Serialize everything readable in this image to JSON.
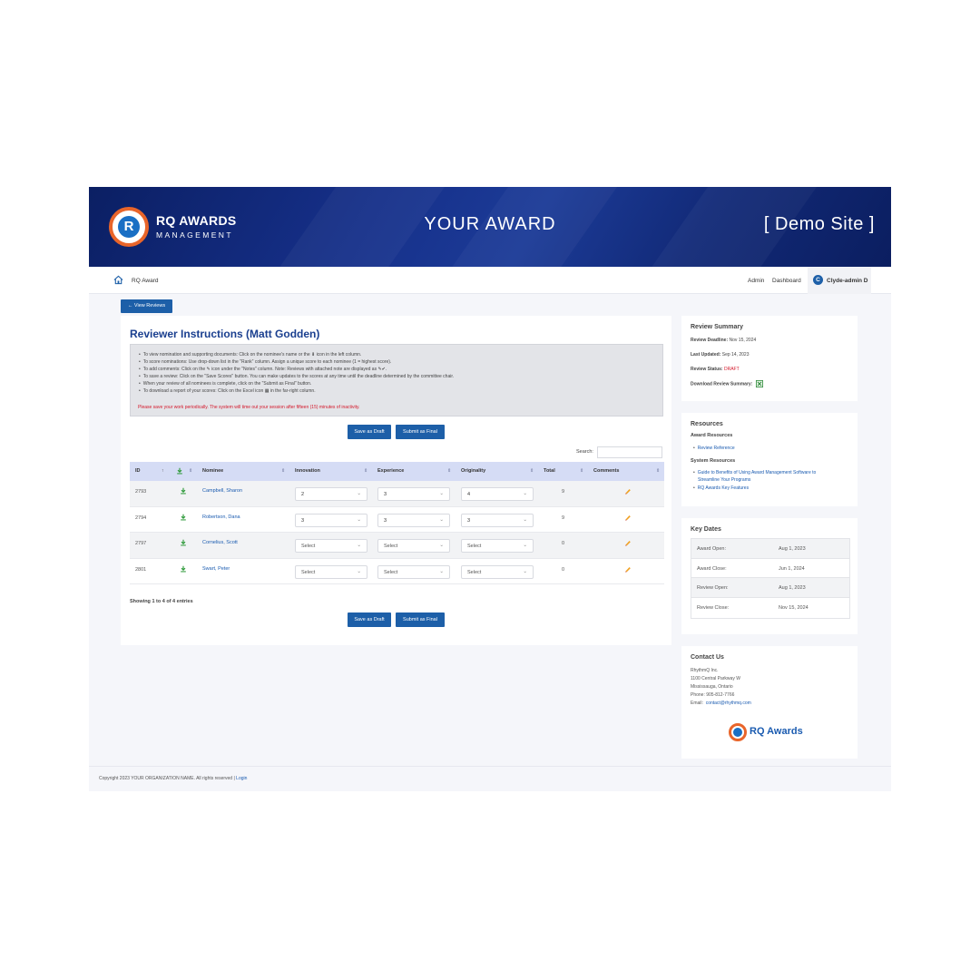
{
  "banner": {
    "brand_name": "RQ AWARDS",
    "brand_sub": "MANAGEMENT",
    "logo_letter": "R",
    "award_title": "YOUR  AWARD",
    "site_label": "[ Demo Site ]"
  },
  "navbar": {
    "breadcrumb": "RQ Award",
    "admin": "Admin",
    "dashboard": "Dashboard",
    "user_initial": "C",
    "user_name": "Clyde-admin D"
  },
  "view_reviews_label": "← View Reviews",
  "instructions": {
    "title": "Reviewer Instructions (Matt Godden)",
    "items": [
      "To view nomination and supporting documents: Click on the nominee's name or the ⬇ icon in the left column.",
      "To score nominations: Use drop-down list in the \"Rank\" column.  Assign a unique score to each nominee (1 =  highest score).",
      "To add comments: Click on the ✎ icon under the \"Notes\" column.  Note: Reviews with attached note are displayed as ✎✔.",
      "To save a review: Click on the \"Save Scores\" button.  You can make updates to the scores at any time until the deadline determined by the committee chair.",
      "When your review of all nominees is complete, click on the \"Submit as Final\" button.",
      "To download a report of your scores: Click on the Excel icon ▦ in the far-right column."
    ],
    "warning": "Please save your work periodically. The system will time out your session after fifteen (15) minutes of inactivity."
  },
  "actions": {
    "save_draft": "Save as Draft",
    "submit_final": "Submit as Final"
  },
  "search_label": "Search:",
  "table": {
    "columns": [
      "ID",
      "Nominee",
      "Innovation",
      "Experience",
      "Originality",
      "Total",
      "Comments"
    ],
    "rows": [
      {
        "id": "2793",
        "nominee": "Campbell, Sharon",
        "innovation": "2",
        "experience": "3",
        "originality": "4",
        "total": "9"
      },
      {
        "id": "2794",
        "nominee": "Robertson, Dana",
        "innovation": "3",
        "experience": "3",
        "originality": "3",
        "total": "9"
      },
      {
        "id": "2797",
        "nominee": "Cornelius, Scott",
        "innovation": "Select",
        "experience": "Select",
        "originality": "Select",
        "total": "0"
      },
      {
        "id": "2801",
        "nominee": "Swart, Peter",
        "innovation": "Select",
        "experience": "Select",
        "originality": "Select",
        "total": "0"
      }
    ],
    "showing": "Showing 1 to 4 of 4 entries"
  },
  "summary": {
    "title": "Review Summary",
    "deadline_label": "Review Deadline:",
    "deadline": "Nov 15, 2024",
    "updated_label": "Last Updated:",
    "updated": "Sep 14, 2023",
    "status_label": "Review Status:",
    "status": "DRAFT",
    "download_label": "Download Review Summary:"
  },
  "resources": {
    "title": "Resources",
    "award_heading": "Award Resources",
    "award_links": [
      "Review Reference"
    ],
    "system_heading": "System Resources",
    "system_link_1_line1": "Guide to Benefits of Using Award Management Software to",
    "system_link_1_line2": "Streamline Your Programs",
    "system_link_2": "RQ Awards Key Features"
  },
  "key_dates": {
    "title": "Key Dates",
    "rows": [
      {
        "label": "Award Open:",
        "value": "Aug 1, 2023"
      },
      {
        "label": "Award Close:",
        "value": "Jun 1, 2024"
      },
      {
        "label": "Review Open:",
        "value": "Aug 1, 2023"
      },
      {
        "label": "Review Close:",
        "value": "Nov 15, 2024"
      }
    ]
  },
  "contact": {
    "title": "Contact Us",
    "company": "RhythmQ Inc.",
    "street": "1100 Central Parkway W",
    "city": "Mississauga, Ontario",
    "phone": "Phone: 905-812-7766",
    "email_label": "Email:",
    "email": "contact@rhythmq.com",
    "logo_text": "RQ Awards"
  },
  "footer": {
    "text": "Copyright  2023 YOUR ORGANIZATION NAME.  All rights reserved | ",
    "login": "Login"
  },
  "colors": {
    "brand_blue": "#1d5fa8",
    "banner_navy": "#0b1f63",
    "logo_orange": "#e9652a",
    "header_row": "#d5dcf5",
    "warning_red": "#d4172a"
  }
}
